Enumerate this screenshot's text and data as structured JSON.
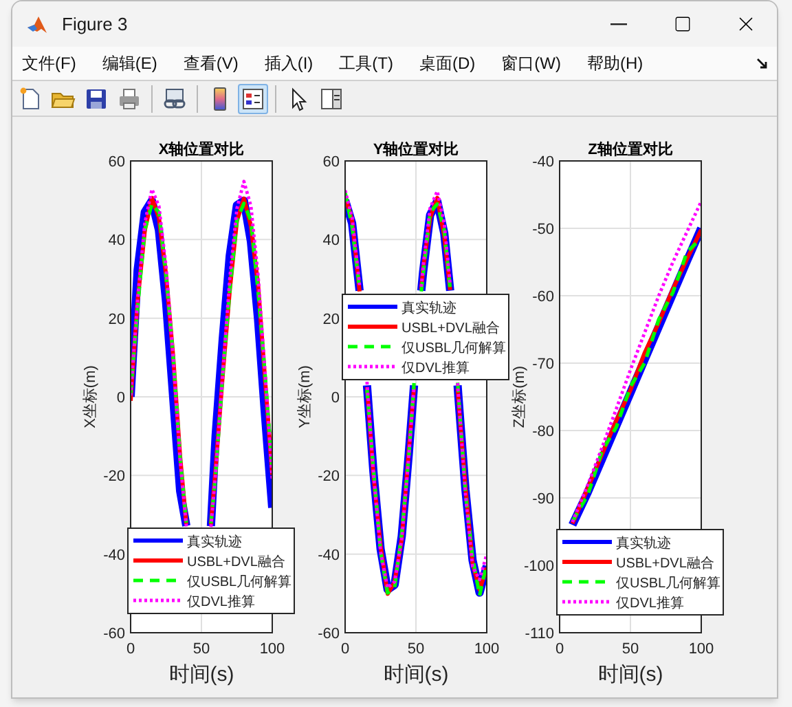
{
  "window": {
    "title": "Figure 3"
  },
  "menu": [
    "文件(F)",
    "编辑(E)",
    "查看(V)",
    "插入(I)",
    "工具(T)",
    "桌面(D)",
    "窗口(W)",
    "帮助(H)"
  ],
  "toolbar": [
    {
      "selected": false
    },
    {
      "selected": false
    },
    {
      "selected": false
    },
    {
      "selected": false
    },
    {
      "selected": false
    },
    {
      "selected": false
    },
    {
      "selected": true
    },
    {
      "selected": false
    },
    {
      "selected": false
    }
  ],
  "plots": [
    {
      "chart_data": {
        "type": "line",
        "title": "X轴位置对比",
        "xlabel": "时间(s)",
        "ylabel": "X坐标(m)",
        "grid": true,
        "legend": true,
        "x": [
          0,
          5,
          10,
          15,
          20,
          25,
          30,
          35,
          39.3,
          45,
          56.7,
          60,
          65,
          70,
          75,
          80,
          85,
          90,
          95,
          100
        ],
        "xlim": [
          0,
          100
        ],
        "ylim": [
          -60,
          60
        ],
        "xticks": [
          0,
          50,
          100
        ],
        "yticks": [
          -60,
          -40,
          -20,
          0,
          20,
          40,
          60
        ],
        "series": [
          {
            "name": "真实轨迹",
            "color": "#0000ff",
            "line_style": "solid",
            "values": [
              0,
              32.2,
              47.0,
              49.9,
              42.4,
              24.1,
              0.2,
              -23.9,
              -32.8,
              null,
              -32.9,
              -10.0,
              14.7,
              35.9,
              48.7,
              49.9,
              39.5,
              19.7,
              -4.9,
              -28.2
            ]
          },
          {
            "name": "USBL+DVL融合",
            "color": "#ff0000",
            "line_style": "solid",
            "values": [
              -1,
              24.5,
              42.3,
              50.6,
              45.5,
              30.9,
              10.5,
              -15.2,
              -32.4,
              null,
              -32.5,
              -18.3,
              5.6,
              27.1,
              44.8,
              50.4,
              43.5,
              28.4,
              4.2,
              -19.8
            ]
          },
          {
            "name": "仅USBL几何解算",
            "color": "#00ff00",
            "line_style": "dashed",
            "values": [
              0.5,
              22.8,
              42.4,
              49.1,
              46.9,
              30.8,
              10.6,
              -15.3,
              -32.0,
              null,
              -32.2,
              -19.9,
              5.7,
              27.0,
              44.9,
              49.2,
              44.8,
              27.0,
              5.6,
              -18.4
            ]
          },
          {
            "name": "仅DVL推算",
            "color": "#ff00ff",
            "line_style": "dotted",
            "values": [
              0.3,
              24.9,
              44.2,
              52.8,
              48.5,
              33.0,
              10.1,
              -15.8,
              -33.0,
              null,
              -33.1,
              -19.3,
              6.0,
              30.1,
              47.9,
              54.8,
              48.5,
              30.9,
              5.8,
              -20.9
            ]
          }
        ]
      }
    },
    {
      "chart_data": {
        "type": "line",
        "title": "Y轴位置对比",
        "xlabel": "时间(s)",
        "ylabel": "Y坐标(m)",
        "grid": true,
        "legend": true,
        "x": [
          0,
          5,
          10.2,
          15,
          15.4,
          20,
          25,
          30,
          35,
          40,
          45,
          48.6,
          50,
          53.8,
          55,
          60,
          65,
          70,
          74.2,
          75,
          79.4,
          80,
          85,
          90,
          95,
          100
        ],
        "xlim": [
          0,
          100
        ],
        "ylim": [
          -60,
          60
        ],
        "xticks": [
          0,
          50,
          100
        ],
        "yticks": [
          -60,
          -40,
          -20,
          0,
          20,
          40,
          60
        ],
        "series": [
          {
            "name": "真实轨迹",
            "color": "#0000ff",
            "line_style": "solid",
            "values": [
              50,
              44.1,
              27.0,
              null,
              2.9,
              -19.1,
              -38.7,
              -49.0,
              -47.8,
              -35.4,
              -14.5,
              2.9,
              null,
              27.0,
              31.7,
              46.2,
              49.8,
              41.6,
              27.0,
              null,
              2.9,
              0,
              -23.6,
              -41.6,
              -49.8,
              -43.0
            ]
          },
          {
            "name": "USBL+DVL融合",
            "color": "#ff0000",
            "line_style": "solid",
            "values": [
              51,
              44.8,
              26.8,
              null,
              2.5,
              -19.8,
              -38.0,
              -50.1,
              -47.1,
              -36.1,
              -13.8,
              2.4,
              null,
              27.3,
              32.4,
              45.5,
              50.6,
              40.9,
              27.2,
              null,
              2.2,
              -0.7,
              -22.9,
              -42.3,
              -49.1,
              -43.5
            ]
          },
          {
            "name": "仅USBL几何解算",
            "color": "#00ff00",
            "line_style": "dashed",
            "values": [
              52,
              43.2,
              27.5,
              null,
              2.0,
              -18.3,
              -39.5,
              -49.9,
              -48.6,
              -34.6,
              -15.3,
              3.5,
              null,
              26.8,
              30.9,
              47.0,
              49.0,
              42.4,
              27.4,
              null,
              3.6,
              0.8,
              -24.4,
              -40.8,
              -50.6,
              -42.2
            ]
          },
          {
            "name": "仅DVL推算",
            "color": "#ff00ff",
            "line_style": "dotted",
            "values": [
              52.5,
              45.6,
              28.4,
              null,
              3.8,
              -19.5,
              -39.4,
              -48.6,
              -47.0,
              -36.2,
              -15.0,
              2.6,
              null,
              28.0,
              33.0,
              48.0,
              52.3,
              44.0,
              28.6,
              null,
              3.5,
              0.4,
              -24.7,
              -43.2,
              -46.5,
              -40.0
            ]
          }
        ]
      }
    },
    {
      "chart_data": {
        "type": "line",
        "title": "Z轴位置对比",
        "xlabel": "时间(s)",
        "ylabel": "Z坐标(m)",
        "grid": true,
        "legend": true,
        "x": [
          9,
          20,
          30,
          40,
          50,
          60,
          70,
          80,
          90,
          100
        ],
        "xlim": [
          0,
          100
        ],
        "ylim": [
          -110,
          -40
        ],
        "xticks": [
          0,
          50,
          100
        ],
        "yticks": [
          -110,
          -100,
          -90,
          -80,
          -70,
          -60,
          -50,
          -40
        ],
        "series": [
          {
            "name": "真实轨迹",
            "color": "#0000ff",
            "line_style": "solid",
            "values": [
              -94.0,
              -89.1,
              -84.2,
              -79.3,
              -74.4,
              -69.5,
              -64.6,
              -59.7,
              -54.8,
              -50.0
            ]
          },
          {
            "name": "USBL+DVL融合",
            "color": "#ff0000",
            "line_style": "solid",
            "values": [
              -93.8,
              -88.5,
              -83.5,
              -78.5,
              -74.0,
              -68.5,
              -64.0,
              -59.0,
              -54.5,
              -50.2
            ]
          },
          {
            "name": "仅USBL几何解算",
            "color": "#00ff00",
            "line_style": "dashed",
            "values": [
              -93.5,
              -89.5,
              -83.0,
              -79.5,
              -73.5,
              -70.0,
              -63.5,
              -59.5,
              -53.5,
              -51.5
            ]
          },
          {
            "name": "仅DVL推算",
            "color": "#ff00ff",
            "line_style": "dotted",
            "values": [
              -93.6,
              -88.0,
              -82.5,
              -76.8,
              -71.0,
              -65.5,
              -60.0,
              -55.0,
              -50.5,
              -46.0
            ]
          }
        ]
      }
    }
  ]
}
